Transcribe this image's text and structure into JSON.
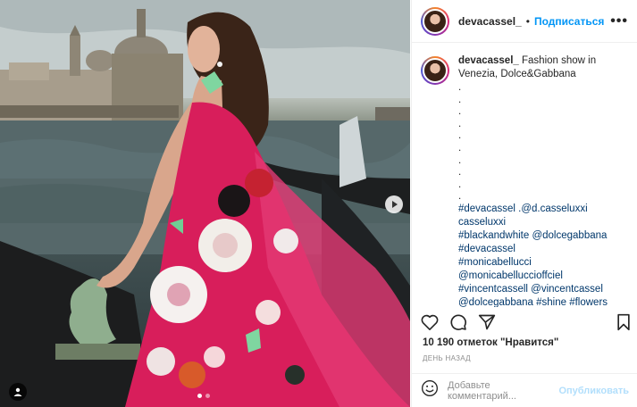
{
  "post": {
    "username": "devacassel_",
    "separator": "•",
    "follow_label": "Подписаться",
    "more_label": "•••"
  },
  "caption": {
    "username": "devacassel_",
    "text": "Fashion show in Venezia, Dolce&Gabbana",
    "dot": ".",
    "lines": [
      "#devacassel .@d.casseluxxi casseluxxi",
      "#blackandwhite @dolcegabbana",
      "#devacassel",
      "#monicabellucci",
      "@monicabelluccioffciel",
      "#vincentcassell @vincentcassel",
      "@dolcegabbana #shine #flowers"
    ]
  },
  "stats": {
    "likes": "10 190 отметок \"Нравится\"",
    "time": "ДЕНЬ НАЗАД"
  },
  "comment": {
    "placeholder": "Добавьте комментарий...",
    "publish": "Опубликовать"
  },
  "carousel": {
    "current": 1,
    "total": 2
  },
  "icons": [
    "heart-icon",
    "comment-icon",
    "share-icon",
    "bookmark-icon",
    "emoji-icon",
    "tag-icon",
    "next-arrow-icon"
  ],
  "colors": {
    "accent": "#0095f6",
    "publish_disabled": "#b2dffc",
    "hashtag": "#00376b",
    "dress": "#d81e5b"
  }
}
